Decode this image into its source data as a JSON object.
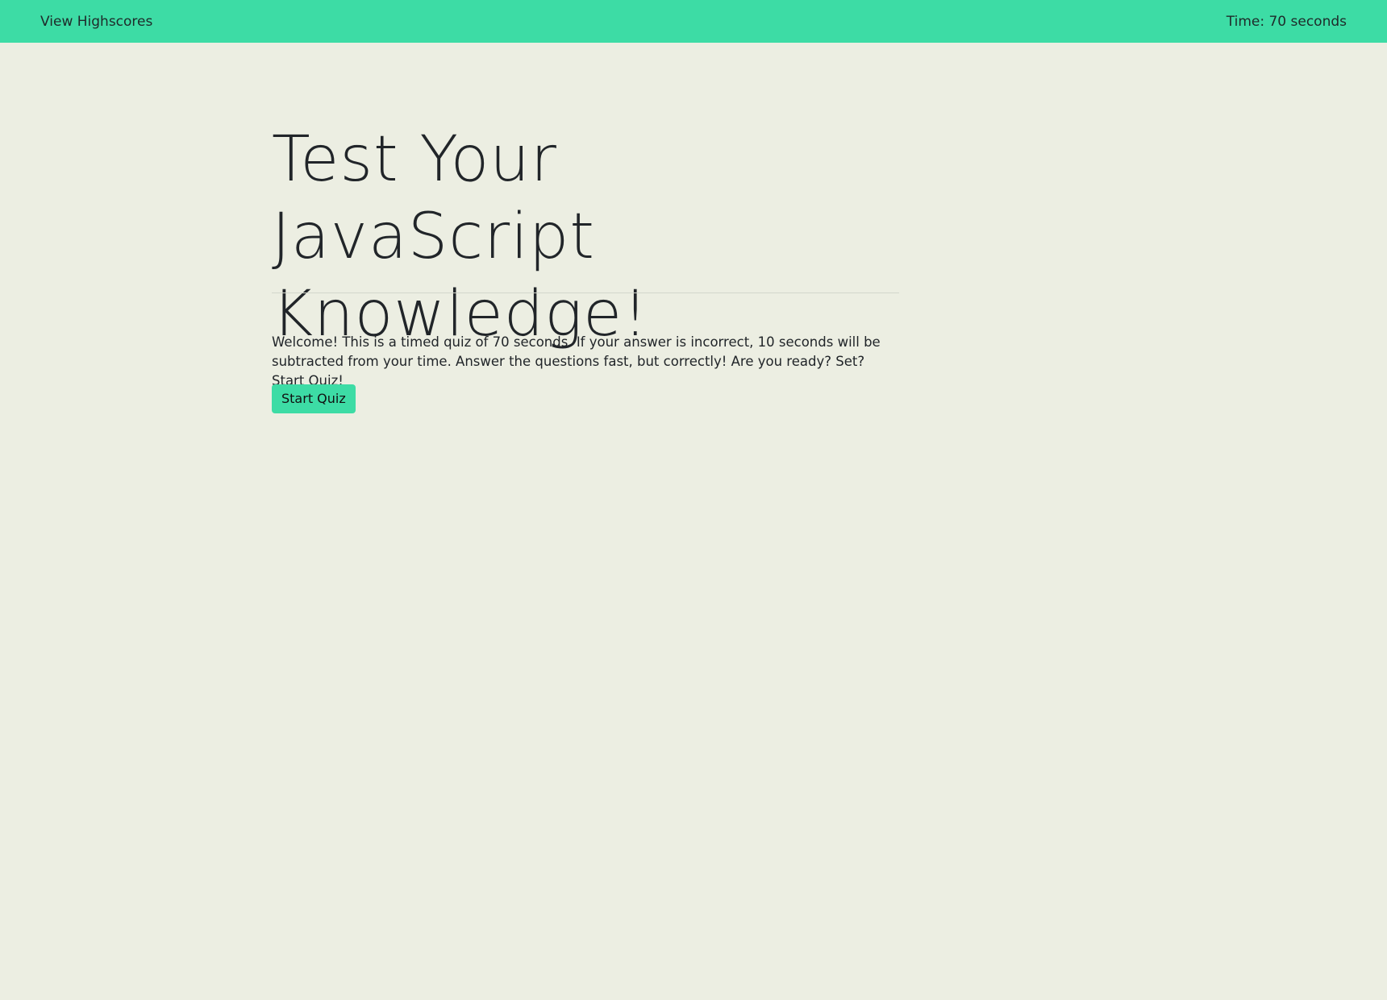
{
  "header": {
    "highscores_label": "View Highscores",
    "timer_text": "Time: 70 seconds"
  },
  "main": {
    "title": "Test Your JavaScript Knowledge!",
    "intro_text": "Welcome! This is a timed quiz of 70 seconds. If your answer is incorrect, 10 seconds will be subtracted from your time. Answer the questions fast, but correctly! Are you ready? Set? Start Quiz!",
    "start_button_label": "Start Quiz"
  },
  "colors": {
    "accent": "#3ddca5",
    "background": "#eceee2",
    "text": "#212529"
  }
}
